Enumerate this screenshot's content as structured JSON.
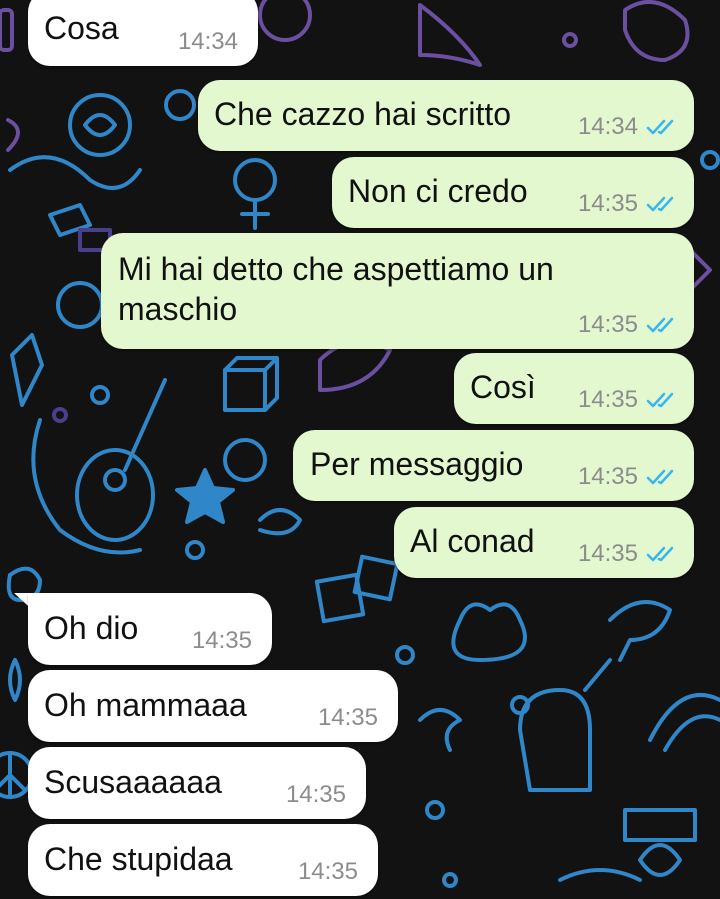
{
  "colors": {
    "incoming_bubble": "#ffffff",
    "outgoing_bubble": "#e3f8cf",
    "timestamp": "#8c8c8c",
    "read_ticks": "#34b7f1",
    "wallpaper_bg": "#121212"
  },
  "icons": {
    "read_receipt": "double-check-icon"
  },
  "messages": [
    {
      "direction": "in",
      "text": "Cosa",
      "time": "14:34"
    },
    {
      "direction": "out",
      "text": "Che cazzo hai scritto",
      "time": "14:34",
      "read": true
    },
    {
      "direction": "out",
      "text": "Non ci credo",
      "time": "14:35",
      "read": true
    },
    {
      "direction": "out",
      "text": "Mi hai detto che aspettiamo un maschio",
      "time": "14:35",
      "read": true
    },
    {
      "direction": "out",
      "text": "Così",
      "time": "14:35",
      "read": true
    },
    {
      "direction": "out",
      "text": "Per messaggio",
      "time": "14:35",
      "read": true
    },
    {
      "direction": "out",
      "text": "Al conad",
      "time": "14:35",
      "read": true
    },
    {
      "direction": "in",
      "text": "Oh dio",
      "time": "14:35"
    },
    {
      "direction": "in",
      "text": "Oh mammaaa",
      "time": "14:35"
    },
    {
      "direction": "in",
      "text": "Scusaaaaaa",
      "time": "14:35"
    },
    {
      "direction": "in",
      "text": "Che stupidaa",
      "time": "14:35"
    }
  ]
}
